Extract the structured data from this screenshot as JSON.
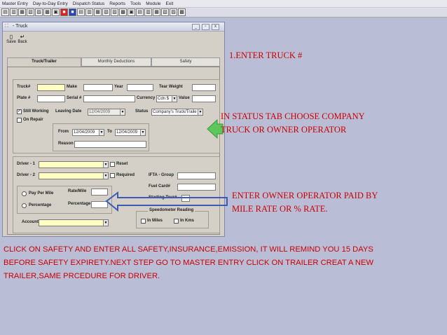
{
  "menu": [
    "Master Entry",
    "Day-to-Day Entry",
    "Dispatch Status",
    "Reports",
    "Tools",
    "Module",
    "Exit"
  ],
  "window": {
    "title": "- Truck",
    "min": "_",
    "restore": "▫",
    "close": "x"
  },
  "actions": {
    "save": "Save",
    "back": "Back"
  },
  "tabs": [
    "Truck/Trailer",
    "Monthly Deductions",
    "Safety"
  ],
  "form": {
    "truck_label": "Truck#",
    "make_label": "Make",
    "year_label": "Year",
    "tear_weight_label": "Tear Weight",
    "plate_label": "Plate #",
    "serial_label": "Serial #",
    "currency_label": "Currency",
    "currency_value": "Cdn $",
    "value_label": "Value",
    "still_working_label": "Still Working",
    "still_working_mark": "✓",
    "leaving_date_label": "Leaving Date",
    "leaving_date_value": "12/04/2009",
    "status_label": "Status",
    "status_value": "Company's Truck/Traile",
    "on_repair_label": "On Repair",
    "from_label": "From",
    "from_value": "12/04/2009",
    "to_label": "To",
    "to_value": "12/04/2009",
    "reason_label": "Reason",
    "driver1_label": "Driver - 1",
    "reset_label": "Reset",
    "driver2_label": "Driver - 2",
    "required_label": "Required",
    "ifta_label": "IFTA - Group",
    "fuel_card_label": "Fuel Card#",
    "starting_tour_label": "Starting Tour#",
    "pay_per_mile_label": "Pay Per Mile",
    "percentage_radio_label": "Percentage",
    "rate_mile_label": "Rate/Mile",
    "percentage_label": "Percentage",
    "account_label": "Account",
    "speedometer_label": "Speedometer Reading",
    "in_miles_label": "In Miles",
    "in_kms_label": "In Kms"
  },
  "annotations": {
    "step1": "1.ENTER TRUCK #",
    "status_line1": "IN STATUS TAB CHOOSE COMPANY",
    "status_line2": "TRUCK OR OWNER OPERATOR",
    "owner_line1": "ENTER OWNER OPERATOR PAID BY",
    "owner_line2": "MILE RATE OR % RATE.",
    "bottom_line1": "CLICK ON SAFETY AND ENTER ALL SAFETY,INSURANCE,EMISSION, IT WILL REMIND YOU 15 DAYS",
    "bottom_line2": "BEFORE SAFETY EXPIRETY.NEXT STEP GO TO  MASTER ENTRY CLICK ON TRAILER CREAT A NEW",
    "bottom_line3": "TRAILER,SAME PRCEDURE FOR DRIVER."
  },
  "colors": {
    "annotation": "#cc0000",
    "arrow_green": "#5cc85c",
    "arrow_blue": "#3a5bb8",
    "desktop": "#b9bed6"
  }
}
